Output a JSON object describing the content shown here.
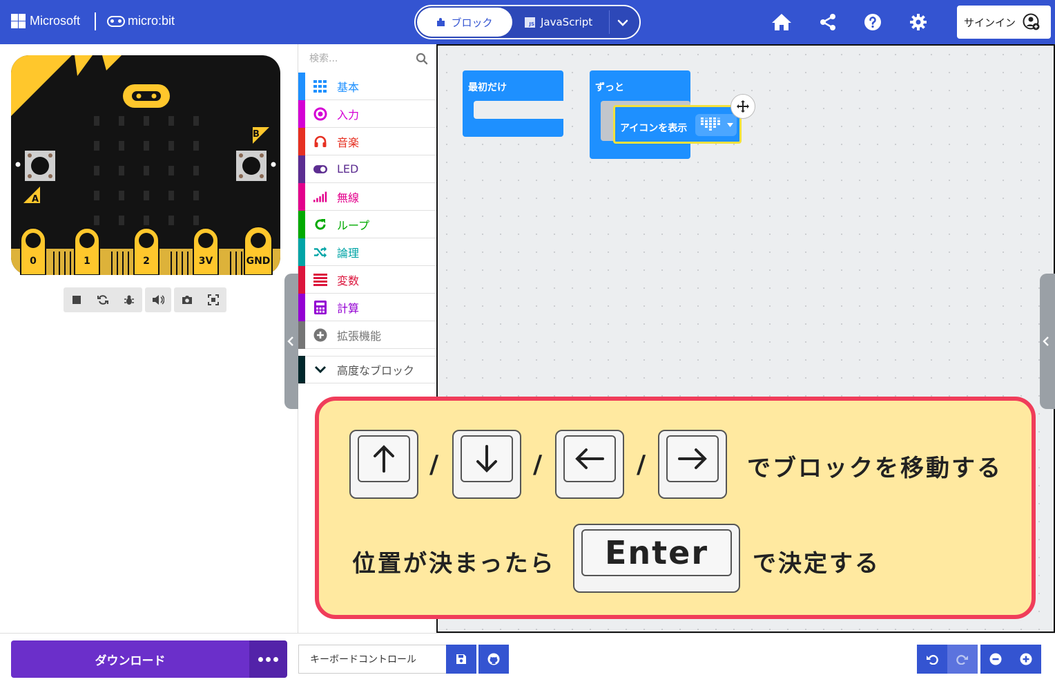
{
  "header": {
    "microsoft_label": "Microsoft",
    "microbit_label": "micro:bit",
    "tab_blocks": "ブロック",
    "tab_javascript": "JavaScript",
    "signin_label": "サインイン"
  },
  "simulator": {
    "pins": [
      "0",
      "1",
      "2",
      "3V",
      "GND"
    ],
    "button_a": "A",
    "button_b": "B"
  },
  "toolbox": {
    "search_placeholder": "検索...",
    "categories": [
      {
        "label": "基本",
        "color": "#1e90ff",
        "icon": "grid-icon"
      },
      {
        "label": "入力",
        "color": "#d400d4",
        "icon": "target-icon"
      },
      {
        "label": "音楽",
        "color": "#e63022",
        "icon": "headphones-icon"
      },
      {
        "label": "LED",
        "color": "#5c2d91",
        "icon": "toggle-icon"
      },
      {
        "label": "無線",
        "color": "#e3008c",
        "icon": "signal-icon"
      },
      {
        "label": "ループ",
        "color": "#00aa00",
        "icon": "refresh-icon"
      },
      {
        "label": "論理",
        "color": "#00a4a6",
        "icon": "shuffle-icon"
      },
      {
        "label": "変数",
        "color": "#dc143c",
        "icon": "lines-icon"
      },
      {
        "label": "計算",
        "color": "#9400d3",
        "icon": "calculator-icon"
      },
      {
        "label": "拡張機能",
        "color": "#757575",
        "icon": "plus-circle-icon"
      },
      {
        "label": "高度なブロック",
        "color": "#00272b",
        "icon": "chevron-down-icon"
      }
    ]
  },
  "workspace": {
    "block_on_start": "最初だけ",
    "block_forever": "ずっと",
    "block_show_icon": "アイコンを表示"
  },
  "overlay": {
    "line1_text": "でブロックを移動する",
    "line2_prefix": "位置が決まったら",
    "enter_key": "Enter",
    "line2_suffix": "で決定する",
    "slash": "/"
  },
  "bottom": {
    "download_label": "ダウンロード",
    "project_name": "キーボードコントロール"
  }
}
